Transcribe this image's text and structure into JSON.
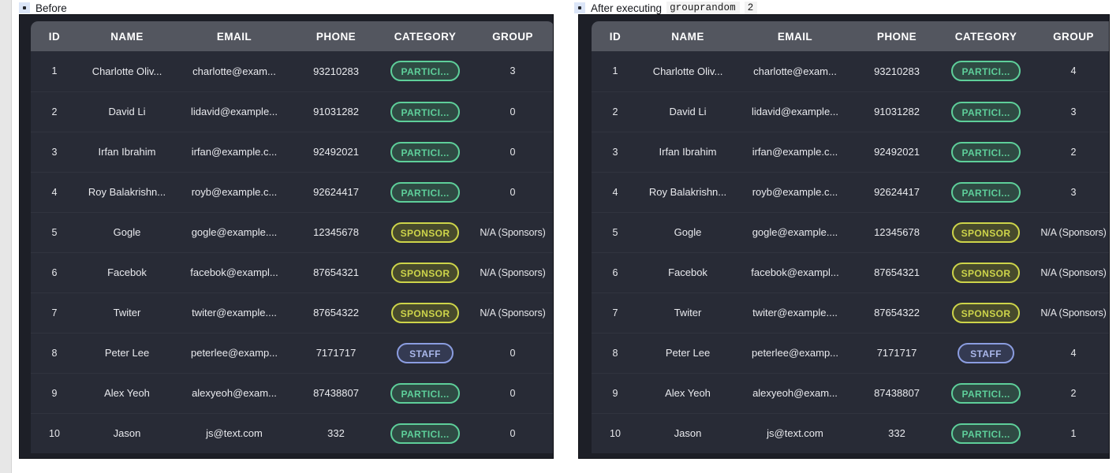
{
  "panels": [
    {
      "caption": {
        "text": "Before",
        "code": "",
        "code_arg": ""
      },
      "table": {
        "columns": [
          "ID",
          "NAME",
          "EMAIL",
          "PHONE",
          "CATEGORY",
          "GROUP"
        ],
        "rows": [
          {
            "id": "1",
            "name": "Charlotte Oliv...",
            "email": "charlotte@exam...",
            "phone": "93210283",
            "category": "PARTICI...",
            "category_type": "participant",
            "group": "3"
          },
          {
            "id": "2",
            "name": "David Li",
            "email": "lidavid@example...",
            "phone": "91031282",
            "category": "PARTICI...",
            "category_type": "participant",
            "group": "0"
          },
          {
            "id": "3",
            "name": "Irfan Ibrahim",
            "email": "irfan@example.c...",
            "phone": "92492021",
            "category": "PARTICI...",
            "category_type": "participant",
            "group": "0"
          },
          {
            "id": "4",
            "name": "Roy Balakrishn...",
            "email": "royb@example.c...",
            "phone": "92624417",
            "category": "PARTICI...",
            "category_type": "participant",
            "group": "0"
          },
          {
            "id": "5",
            "name": "Gogle",
            "email": "gogle@example....",
            "phone": "12345678",
            "category": "SPONSOR",
            "category_type": "sponsor",
            "group": "N/A (Sponsors)"
          },
          {
            "id": "6",
            "name": "Facebok",
            "email": "facebok@exampl...",
            "phone": "87654321",
            "category": "SPONSOR",
            "category_type": "sponsor",
            "group": "N/A (Sponsors)"
          },
          {
            "id": "7",
            "name": "Twiter",
            "email": "twiter@example....",
            "phone": "87654322",
            "category": "SPONSOR",
            "category_type": "sponsor",
            "group": "N/A (Sponsors)"
          },
          {
            "id": "8",
            "name": "Peter Lee",
            "email": "peterlee@examp...",
            "phone": "7171717",
            "category": "STAFF",
            "category_type": "staff",
            "group": "0"
          },
          {
            "id": "9",
            "name": "Alex Yeoh",
            "email": "alexyeoh@exam...",
            "phone": "87438807",
            "category": "PARTICI...",
            "category_type": "participant",
            "group": "0"
          },
          {
            "id": "10",
            "name": "Jason",
            "email": "js@text.com",
            "phone": "332",
            "category": "PARTICI...",
            "category_type": "participant",
            "group": "0"
          }
        ]
      }
    },
    {
      "caption": {
        "text": "After executing",
        "code": "grouprandom",
        "code_arg": "2"
      },
      "table": {
        "columns": [
          "ID",
          "NAME",
          "EMAIL",
          "PHONE",
          "CATEGORY",
          "GROUP"
        ],
        "rows": [
          {
            "id": "1",
            "name": "Charlotte Oliv...",
            "email": "charlotte@exam...",
            "phone": "93210283",
            "category": "PARTICI...",
            "category_type": "participant",
            "group": "4"
          },
          {
            "id": "2",
            "name": "David Li",
            "email": "lidavid@example...",
            "phone": "91031282",
            "category": "PARTICI...",
            "category_type": "participant",
            "group": "3"
          },
          {
            "id": "3",
            "name": "Irfan Ibrahim",
            "email": "irfan@example.c...",
            "phone": "92492021",
            "category": "PARTICI...",
            "category_type": "participant",
            "group": "2"
          },
          {
            "id": "4",
            "name": "Roy Balakrishn...",
            "email": "royb@example.c...",
            "phone": "92624417",
            "category": "PARTICI...",
            "category_type": "participant",
            "group": "3"
          },
          {
            "id": "5",
            "name": "Gogle",
            "email": "gogle@example....",
            "phone": "12345678",
            "category": "SPONSOR",
            "category_type": "sponsor",
            "group": "N/A (Sponsors)"
          },
          {
            "id": "6",
            "name": "Facebok",
            "email": "facebok@exampl...",
            "phone": "87654321",
            "category": "SPONSOR",
            "category_type": "sponsor",
            "group": "N/A (Sponsors)"
          },
          {
            "id": "7",
            "name": "Twiter",
            "email": "twiter@example....",
            "phone": "87654322",
            "category": "SPONSOR",
            "category_type": "sponsor",
            "group": "N/A (Sponsors)"
          },
          {
            "id": "8",
            "name": "Peter Lee",
            "email": "peterlee@examp...",
            "phone": "7171717",
            "category": "STAFF",
            "category_type": "staff",
            "group": "4"
          },
          {
            "id": "9",
            "name": "Alex Yeoh",
            "email": "alexyeoh@exam...",
            "phone": "87438807",
            "category": "PARTICI...",
            "category_type": "participant",
            "group": "2"
          },
          {
            "id": "10",
            "name": "Jason",
            "email": "js@text.com",
            "phone": "332",
            "category": "PARTICI...",
            "category_type": "participant",
            "group": "1"
          }
        ]
      }
    }
  ],
  "colors": {
    "participant": "#5ecf9a",
    "sponsor": "#cdd44a",
    "staff": "#8b9de0",
    "table_bg": "#282b36",
    "header_bg": "#53565f",
    "shell_bg": "#1d1f27"
  }
}
